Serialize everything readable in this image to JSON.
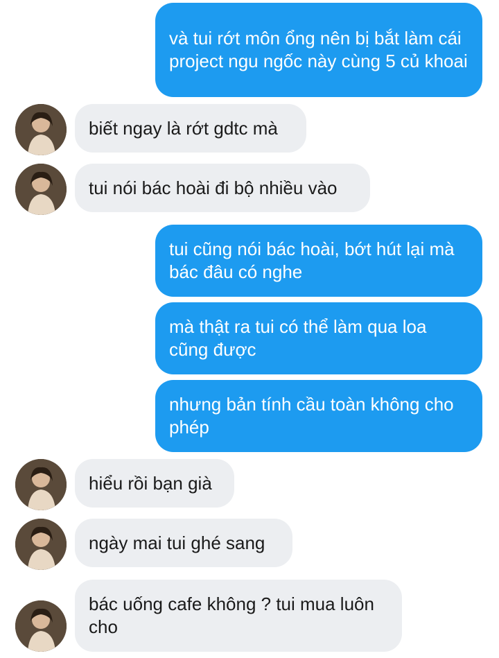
{
  "messages": [
    {
      "side": "sent",
      "text": "và tui rớt môn ổng nên bị bắt làm cái project ngu ngốc này cùng 5 củ khoai"
    },
    {
      "side": "recv",
      "text": "biết ngay là rớt gdtc mà"
    },
    {
      "side": "recv",
      "text": "tui nói bác hoài đi bộ nhiều vào"
    },
    {
      "side": "sent",
      "text": "tui cũng nói bác hoài, bớt hút lại mà bác đâu có nghe"
    },
    {
      "side": "sent",
      "text": "mà thật ra tui có thể làm qua loa cũng được"
    },
    {
      "side": "sent",
      "text": "nhưng bản tính cầu toàn không cho phép"
    },
    {
      "side": "recv",
      "text": "hiểu rồi bạn già"
    },
    {
      "side": "recv",
      "text": "ngày mai tui ghé sang"
    },
    {
      "side": "recv",
      "text": "bác uống cafe không ? tui mua luôn cho"
    }
  ],
  "colors": {
    "sent_bubble": "#1d9bf0",
    "recv_bubble": "#eceef1"
  },
  "avatar_icon": "contact-avatar-photo"
}
